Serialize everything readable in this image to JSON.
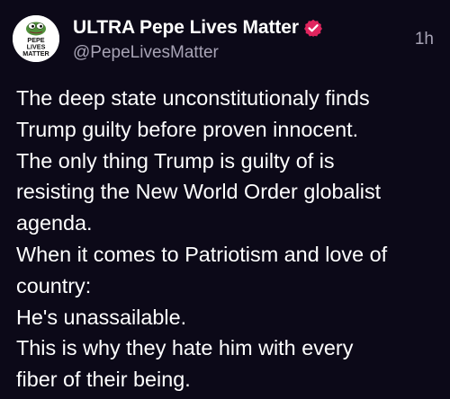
{
  "post": {
    "author": {
      "display_name": "ULTRA Pepe Lives Matter",
      "handle": "@PepeLivesMatter",
      "verified": true,
      "avatar_icon": "pepe-lives-matter-avatar",
      "avatar_text": [
        "PEPE",
        "LIVES",
        "MATTER"
      ]
    },
    "timestamp": "1h",
    "body_lines": [
      "The deep state unconstitutionaly finds",
      "Trump guilty before proven innocent.",
      "The only thing Trump is guilty of is",
      "resisting the New World Order globalist",
      "agenda.",
      "When it comes to Patriotism and love of",
      "country:",
      "He's unassailable.",
      "This is why they hate him with every",
      "fiber of their being."
    ]
  },
  "colors": {
    "background": "#0c0918",
    "text_primary": "#ffffff",
    "text_secondary": "#a7a3b5",
    "verified_badge": "#e0245e"
  }
}
